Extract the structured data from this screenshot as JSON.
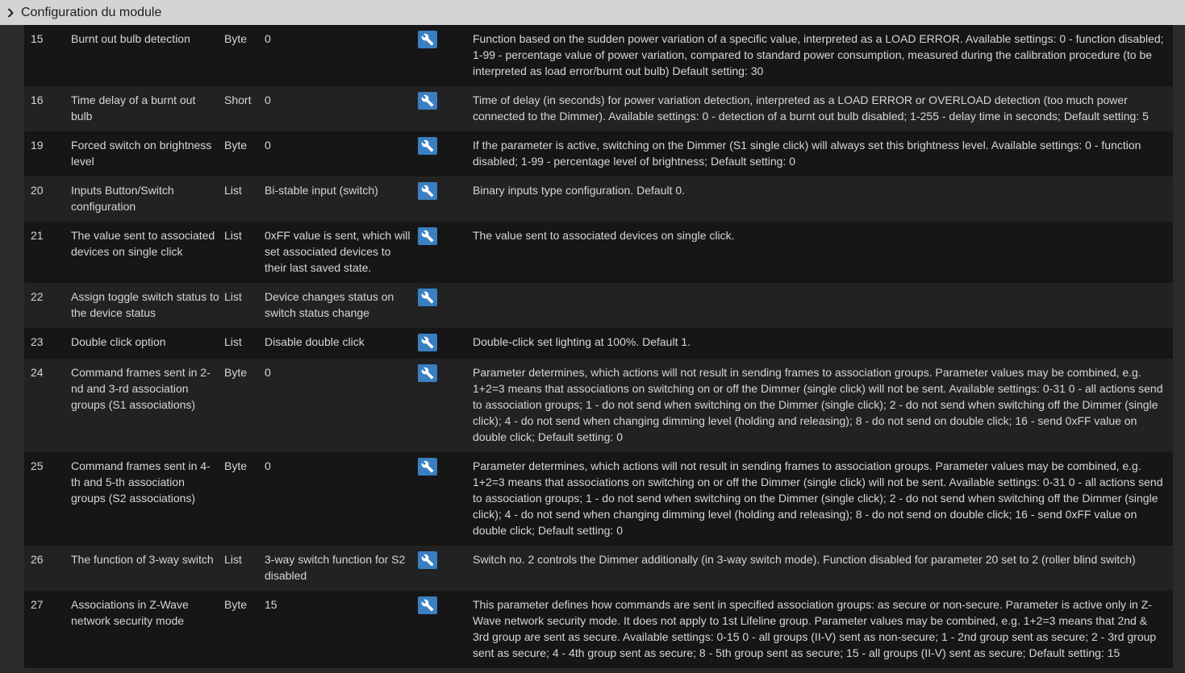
{
  "header": {
    "title": "Configuration du module"
  },
  "rows": [
    {
      "id": "15",
      "label": "Burnt out bulb detection",
      "type": "Byte",
      "value": "0",
      "desc": "Function based on the sudden power variation of a specific value, interpreted as a LOAD ERROR. Available settings: 0 - function disabled; 1-99 - percentage value of power variation, compared to standard power consumption, measured during the calibration procedure (to be interpreted as load error/burnt out bulb) Default setting: 30"
    },
    {
      "id": "16",
      "label": "Time delay of a burnt out bulb",
      "type": "Short",
      "value": "0",
      "desc": "Time of delay (in seconds) for power variation detection, interpreted as a LOAD ERROR or OVERLOAD detection (too much power connected to the Dimmer). Available settings: 0 - detection of a burnt out bulb disabled; 1-255 - delay time in seconds; Default setting: 5"
    },
    {
      "id": "19",
      "label": "Forced switch on brightness level",
      "type": "Byte",
      "value": "0",
      "desc": "If the parameter is active, switching on the Dimmer (S1 single click) will always set this brightness level. Available settings: 0 - function disabled; 1-99 - percentage level of brightness; Default setting: 0"
    },
    {
      "id": "20",
      "label": "Inputs Button/Switch configuration",
      "type": "List",
      "value": "Bi-stable input (switch)",
      "desc": "Binary inputs type configuration. Default 0."
    },
    {
      "id": "21",
      "label": "The value sent to associated devices on single click",
      "type": "List",
      "value": "0xFF value is sent, which will set associated devices to their last saved state.",
      "desc": "The value sent to associated devices on single click."
    },
    {
      "id": "22",
      "label": "Assign toggle switch status to the device status",
      "type": "List",
      "value": "Device changes status on switch status change",
      "desc": ""
    },
    {
      "id": "23",
      "label": "Double click option",
      "type": "List",
      "value": "Disable double click",
      "desc": "Double-click set lighting at 100%. Default 1."
    },
    {
      "id": "24",
      "label": "Command frames sent in 2-nd and 3-rd association groups (S1 associations)",
      "type": "Byte",
      "value": "0",
      "desc": "Parameter determines, which actions will not result in sending frames to association groups. Parameter values may be combined, e.g. 1+2=3 means that associations on switching on or off the Dimmer (single click) will not be sent. Available settings: 0-31 0 - all actions send to association groups; 1 - do not send when switching on the Dimmer (single click); 2 - do not send when switching off the Dimmer (single click); 4 - do not send when changing dimming level (holding and releasing); 8 - do not send on double click; 16 - send 0xFF value on double click; Default setting: 0"
    },
    {
      "id": "25",
      "label": "Command frames sent in 4-th and 5-th association groups (S2 associations)",
      "type": "Byte",
      "value": "0",
      "desc": "Parameter determines, which actions will not result in sending frames to association groups. Parameter values may be combined, e.g. 1+2=3 means that associations on switching on or off the Dimmer (single click) will not be sent. Available settings: 0-31 0 - all actions send to association groups; 1 - do not send when switching on the Dimmer (single click); 2 - do not send when switching off the Dimmer (single click); 4 - do not send when changing dimming level (holding and releasing); 8 - do not send on double click; 16 - send 0xFF value on double click; Default setting: 0"
    },
    {
      "id": "26",
      "label": "The function of 3-way switch",
      "type": "List",
      "value": "3-way switch function for S2 disabled",
      "desc": "Switch no. 2 controls the Dimmer additionally (in 3-way switch mode). Function disabled for parameter 20 set to 2 (roller blind switch)"
    },
    {
      "id": "27",
      "label": "Associations in Z-Wave network security mode",
      "type": "Byte",
      "value": "15",
      "desc": "This parameter defines how commands are sent in specified association groups: as secure or non-secure. Parameter is active only in Z-Wave network security mode. It does not apply to 1st Lifeline group. Parameter values may be combined, e.g. 1+2=3 means that 2nd & 3rd group are sent as secure. Available settings: 0-15 0 - all groups (II-V) sent as non-secure; 1 - 2nd group sent as secure; 2 - 3rd group sent as secure; 4 - 4th group sent as secure; 8 - 5th group sent as secure; 15 - all groups (II-V) sent as secure; Default setting: 15"
    }
  ]
}
